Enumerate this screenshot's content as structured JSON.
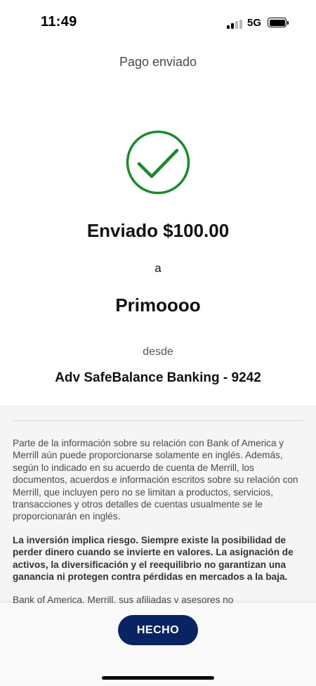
{
  "status_bar": {
    "time": "11:49",
    "network": "5G"
  },
  "header": {
    "title": "Pago enviado"
  },
  "confirmation": {
    "sent_amount": "Enviado $100.00",
    "to_label": "a",
    "recipient": "Primoooo",
    "from_label": "desde",
    "account": "Adv SafeBalance Banking - 9242",
    "icon": "check-circle-icon",
    "accent_color": "#1a8a2e"
  },
  "disclosure": {
    "paragraph1": "Parte de la información sobre su relación con Bank of America y Merrill aún puede proporcionarse solamente en inglés. Además, según lo indicado en su acuerdo de cuenta de Merrill, los documentos, acuerdos e información escritos sobre su relación con Merrill, que incluyen pero no se limitan a productos, servicios, transacciones y otros detalles de cuentas usualmente se le proporcionarán en inglés.",
    "paragraph2": "La inversión implica riesgo. Siempre existe la posibilidad de perder dinero cuando se invierte en valores. La asignación de activos, la diversificación y el reequilibrio no garantizan una ganancia ni protegen contra pérdidas en mercados a la baja.",
    "paragraph3": "Bank of America, Merrill, sus afiliadas y asesores no"
  },
  "footer": {
    "done_label": "HECHO",
    "button_color": "#0a2463"
  }
}
